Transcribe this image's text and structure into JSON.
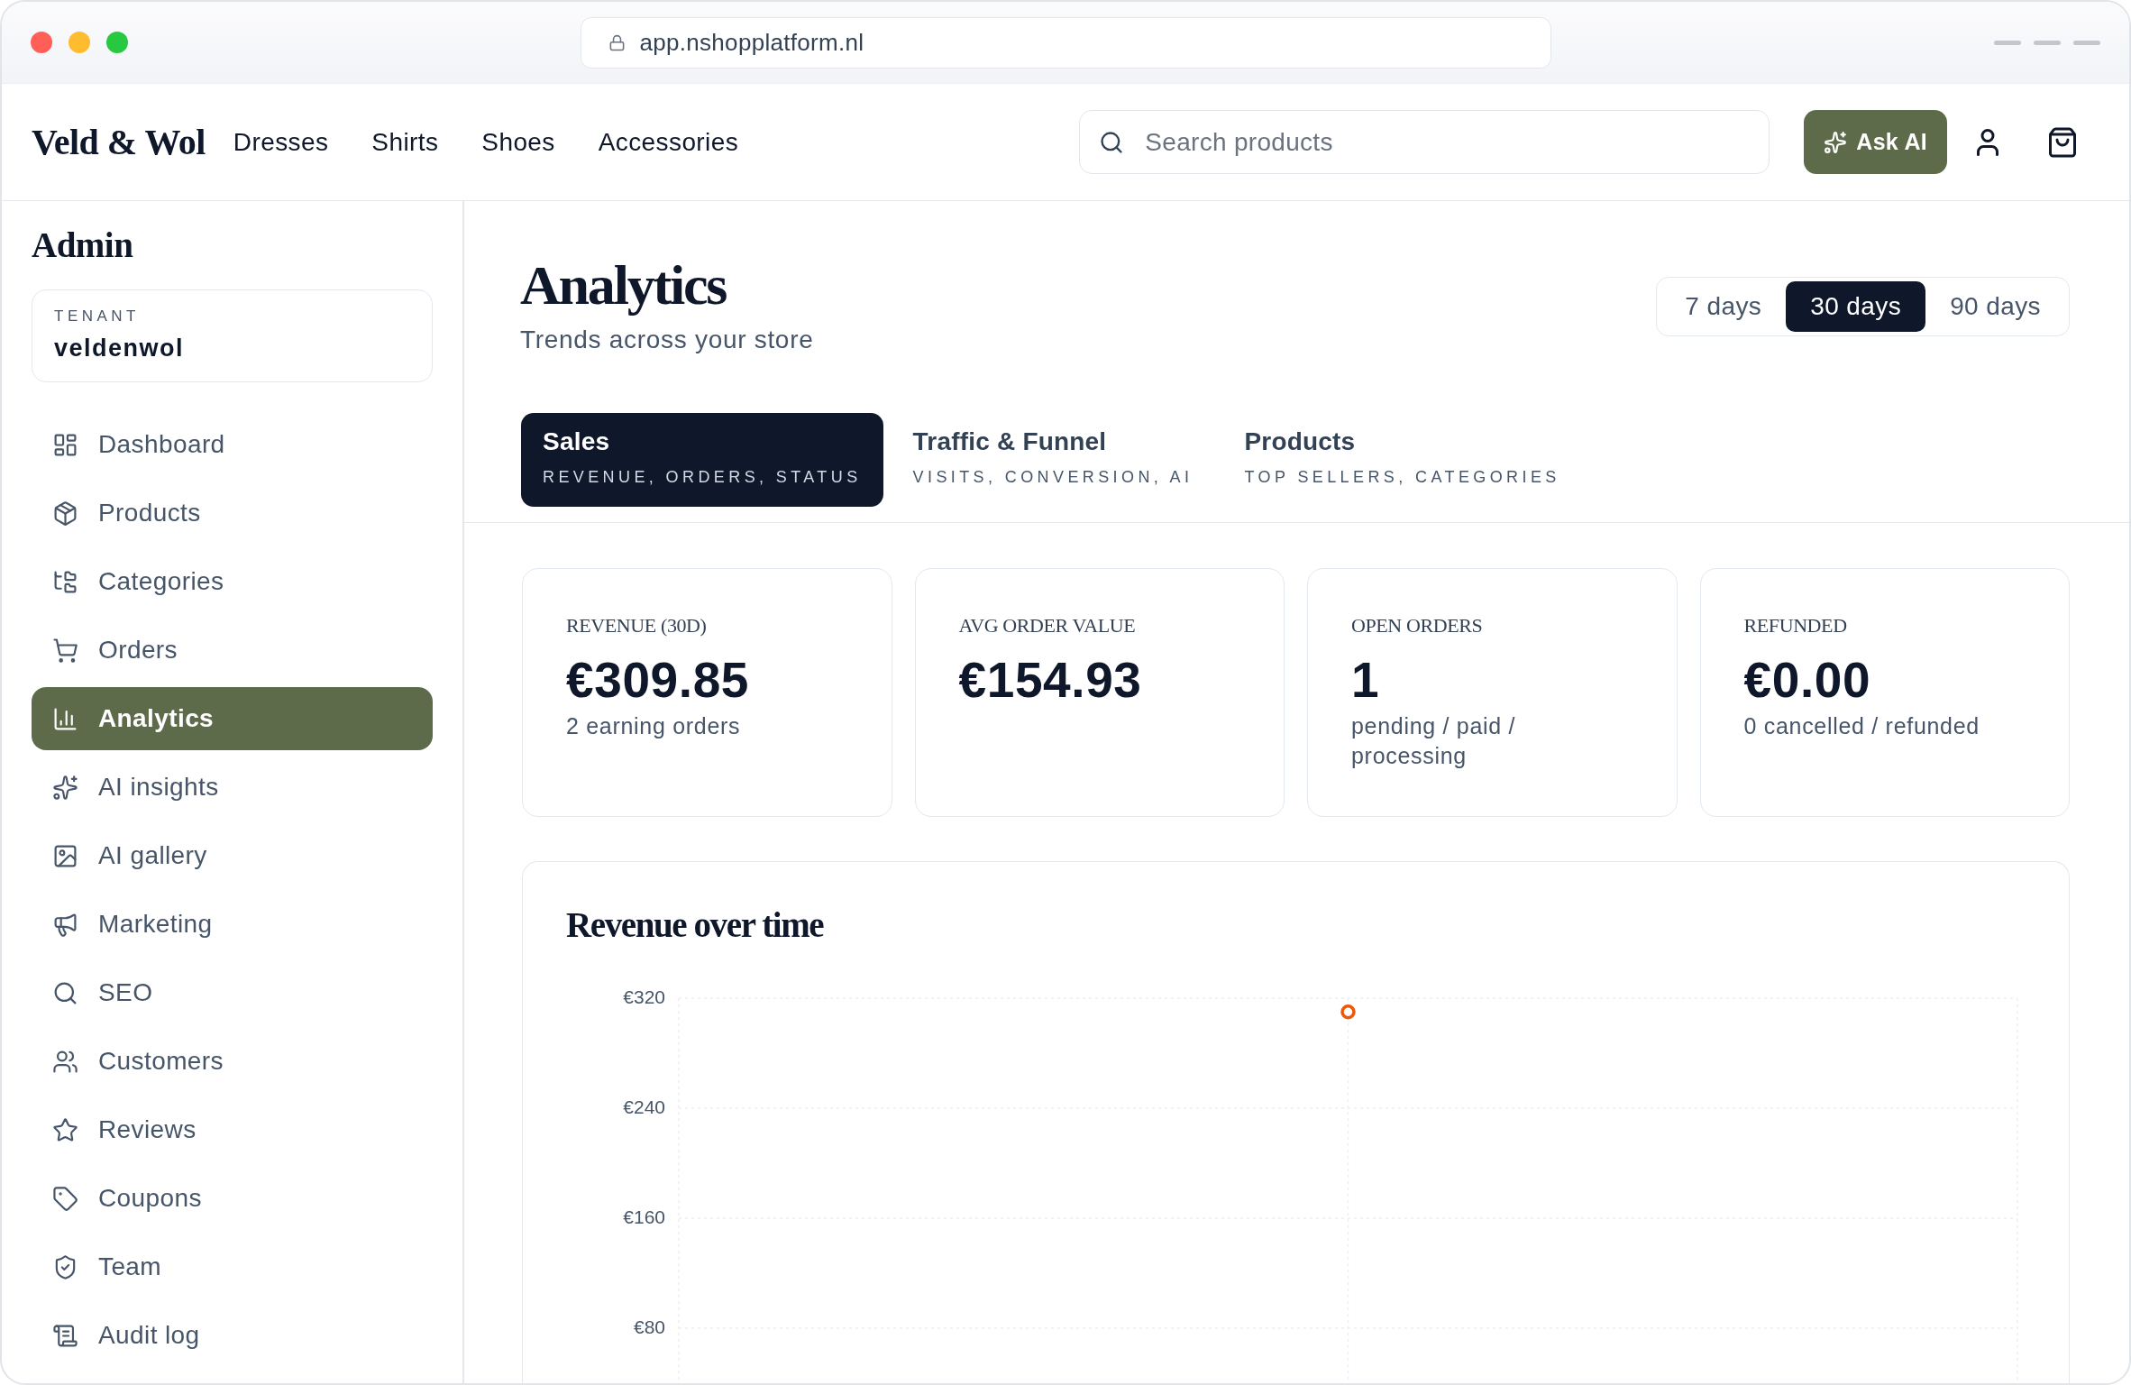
{
  "browser": {
    "url": "app.nshopplatform.nl"
  },
  "header": {
    "logo": "Veld & Wol",
    "nav": [
      "Dresses",
      "Shirts",
      "Shoes",
      "Accessories"
    ],
    "search": {
      "placeholder": "Search products"
    },
    "ask_ai": "Ask AI"
  },
  "sidebar": {
    "title": "Admin",
    "tenant": {
      "label": "TENANT",
      "value": "veldenwol"
    },
    "items": [
      {
        "label": "Dashboard",
        "selected": false
      },
      {
        "label": "Products",
        "selected": false
      },
      {
        "label": "Categories",
        "selected": false
      },
      {
        "label": "Orders",
        "selected": false
      },
      {
        "label": "Analytics",
        "selected": true
      },
      {
        "label": "AI insights",
        "selected": false
      },
      {
        "label": "AI gallery",
        "selected": false
      },
      {
        "label": "Marketing",
        "selected": false
      },
      {
        "label": "SEO",
        "selected": false
      },
      {
        "label": "Customers",
        "selected": false
      },
      {
        "label": "Reviews",
        "selected": false
      },
      {
        "label": "Coupons",
        "selected": false
      },
      {
        "label": "Team",
        "selected": false
      },
      {
        "label": "Audit log",
        "selected": false
      }
    ]
  },
  "page": {
    "title": "Analytics",
    "subtitle": "Trends across your store",
    "ranges": [
      {
        "label": "7 days",
        "selected": false
      },
      {
        "label": "30 days",
        "selected": true
      },
      {
        "label": "90 days",
        "selected": false
      }
    ]
  },
  "tabs": [
    {
      "title": "Sales",
      "subtitle": "REVENUE, ORDERS, STATUS",
      "selected": true
    },
    {
      "title": "Traffic & Funnel",
      "subtitle": "VISITS, CONVERSION, AI",
      "selected": false
    },
    {
      "title": "Products",
      "subtitle": "TOP SELLERS, CATEGORIES",
      "selected": false
    }
  ],
  "stats": [
    {
      "label": "REVENUE (30D)",
      "value": "€309.85",
      "note": "2 earning orders"
    },
    {
      "label": "AVG ORDER VALUE",
      "value": "€154.93"
    },
    {
      "label": "OPEN ORDERS",
      "value": "1",
      "note": "pending / paid / processing"
    },
    {
      "label": "REFUNDED",
      "value": "€0.00",
      "note": "0 cancelled / refunded"
    }
  ],
  "revenue_chart": {
    "chart_data": {
      "type": "line",
      "title": "Revenue over time",
      "ylim": [
        0,
        320
      ],
      "yticks": [
        {
          "value": 80,
          "label": "€80"
        },
        {
          "value": 160,
          "label": "€160"
        },
        {
          "value": 240,
          "label": "€240"
        },
        {
          "value": 320,
          "label": "€320"
        }
      ],
      "grid": true,
      "series": [
        {
          "color": "#ea580c",
          "marker": "circle",
          "values": [
            310
          ]
        }
      ]
    }
  }
}
